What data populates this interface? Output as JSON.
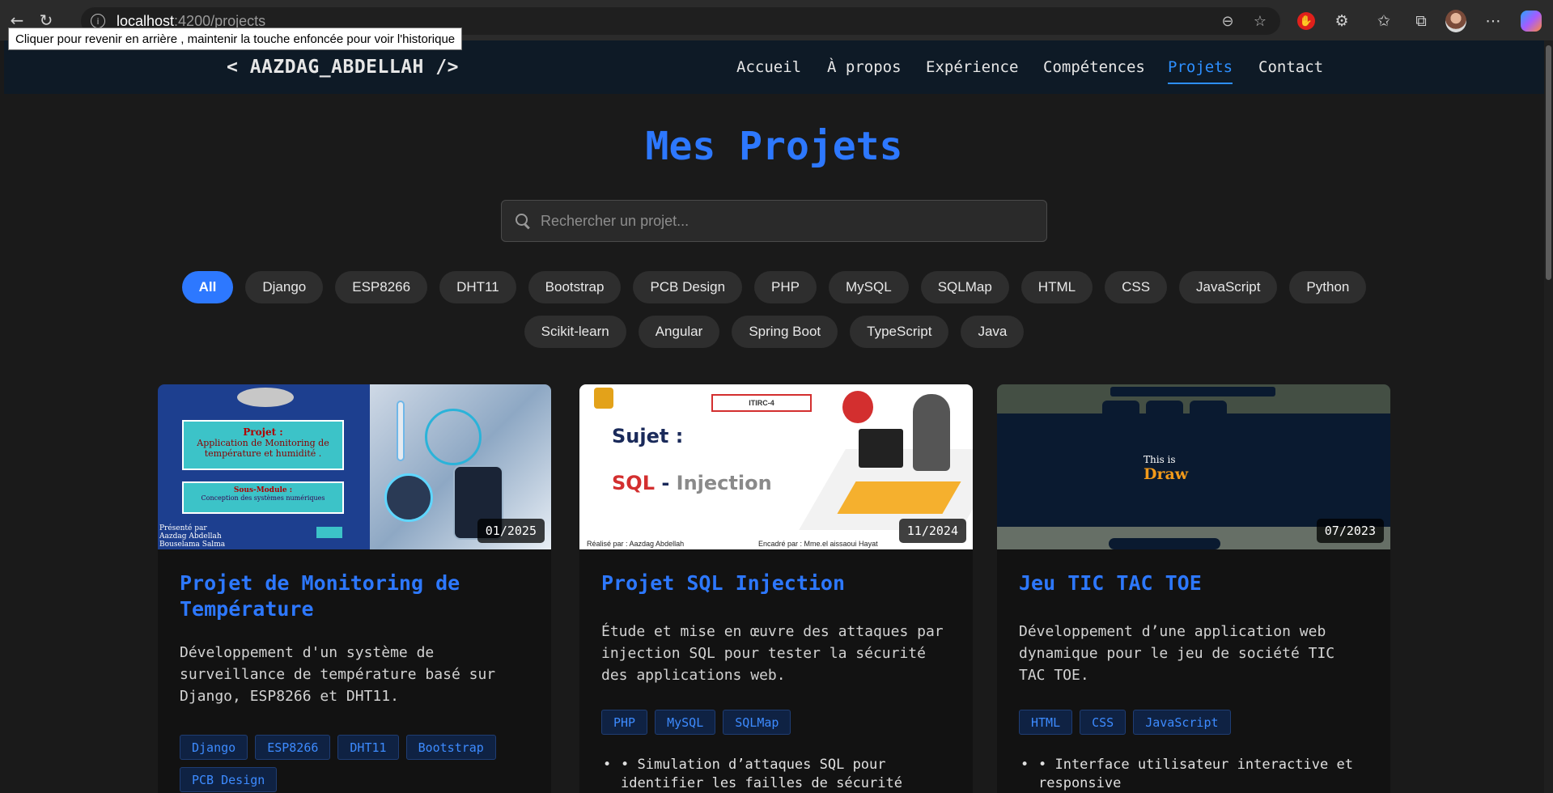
{
  "browser": {
    "url_host": "localhost",
    "url_path": ":4200/projects",
    "tooltip": "Cliquer pour revenir en arrière , maintenir la touche enfoncée pour voir l'historique"
  },
  "site": {
    "brand": "< AAZDAG_ABDELLAH />",
    "nav": [
      "Accueil",
      "À propos",
      "Expérience",
      "Compétences",
      "Projets",
      "Contact"
    ],
    "active_nav": "Projets"
  },
  "page": {
    "title": "Mes Projets",
    "search_placeholder": "Rechercher un projet...",
    "filters_row1": [
      "All",
      "Django",
      "ESP8266",
      "DHT11",
      "Bootstrap",
      "PCB Design",
      "PHP",
      "MySQL",
      "SQLMap",
      "HTML",
      "CSS",
      "JavaScript",
      "Python"
    ],
    "filters_row2": [
      "Scikit-learn",
      "Angular",
      "Spring Boot",
      "TypeScript",
      "Java"
    ],
    "active_filter": "All"
  },
  "projects": [
    {
      "date": "01/2025",
      "title": "Projet de Monitoring de Température",
      "description": "Développement d'un système de surveillance de température basé sur Django, ESP8266 et DHT11.",
      "tags": [
        "Django",
        "ESP8266",
        "DHT11",
        "Bootstrap",
        "PCB Design"
      ],
      "thumb": {
        "projet_label": "Projet :",
        "projet_text": "Application de Monitoring de température et humidité .",
        "module_label": "Sous-Module :",
        "module_text": "Conception des systèmes numériques",
        "presented": "Présenté par",
        "name1": "Aazdag Abdellah",
        "name2": "Bouselama Salma"
      }
    },
    {
      "date": "11/2024",
      "title": "Projet SQL Injection",
      "description": "Étude et mise en œuvre des attaques par injection SQL pour tester la sécurité des applications web.",
      "tags": [
        "PHP",
        "MySQL",
        "SQLMap"
      ],
      "features": [
        "• Simulation d’attaques SQL pour identifier les failles de sécurité"
      ],
      "thumb": {
        "class_label": "ITIRC-4",
        "sujet": "Sujet :",
        "sql": "SQL",
        "dash": " - ",
        "injection": "Injection",
        "realise": "Réalisé par : Aazdag Abdellah",
        "encadre": "Encadré par : Mme.el aissaoui Hayat"
      }
    },
    {
      "date": "07/2023",
      "title": "Jeu TIC TAC TOE",
      "description": "Développement d’une application web dynamique pour le jeu de société TIC TAC TOE.",
      "tags": [
        "HTML",
        "CSS",
        "JavaScript"
      ],
      "features": [
        "• Interface utilisateur interactive et responsive"
      ],
      "thumb": {
        "line1": "This is",
        "line2": "Draw"
      }
    }
  ],
  "colors": {
    "accent": "#2d78ff",
    "header_bg": "#0e1a26",
    "page_bg": "#1a1a1a",
    "card_bg": "#121212"
  }
}
